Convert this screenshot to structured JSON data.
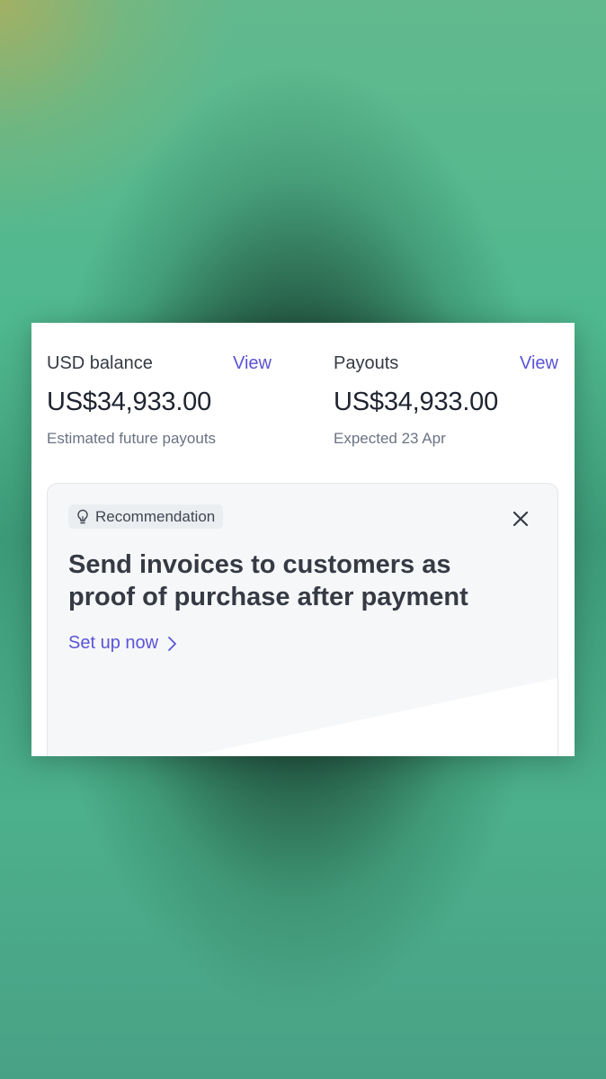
{
  "balance": {
    "title": "USD balance",
    "link": "View",
    "amount": "US$34,933.00",
    "subtitle": "Estimated future payouts"
  },
  "payouts": {
    "title": "Payouts",
    "link": "View",
    "amount": "US$34,933.00",
    "subtitle": "Expected 23 Apr"
  },
  "recommendation": {
    "badge_label": "Recommendation",
    "badge_icon": "lightbulb-icon",
    "close_icon": "close-icon",
    "title": "Send invoices to customers as proof of purchase after payment",
    "cta_label": "Set up now",
    "cta_icon": "chevron-right-icon"
  },
  "colors": {
    "accent": "#5b54d6",
    "text_primary": "#1f2430",
    "text_secondary": "#6a7383",
    "card_bg": "#ffffff",
    "reco_bg": "#f6f7f9"
  }
}
